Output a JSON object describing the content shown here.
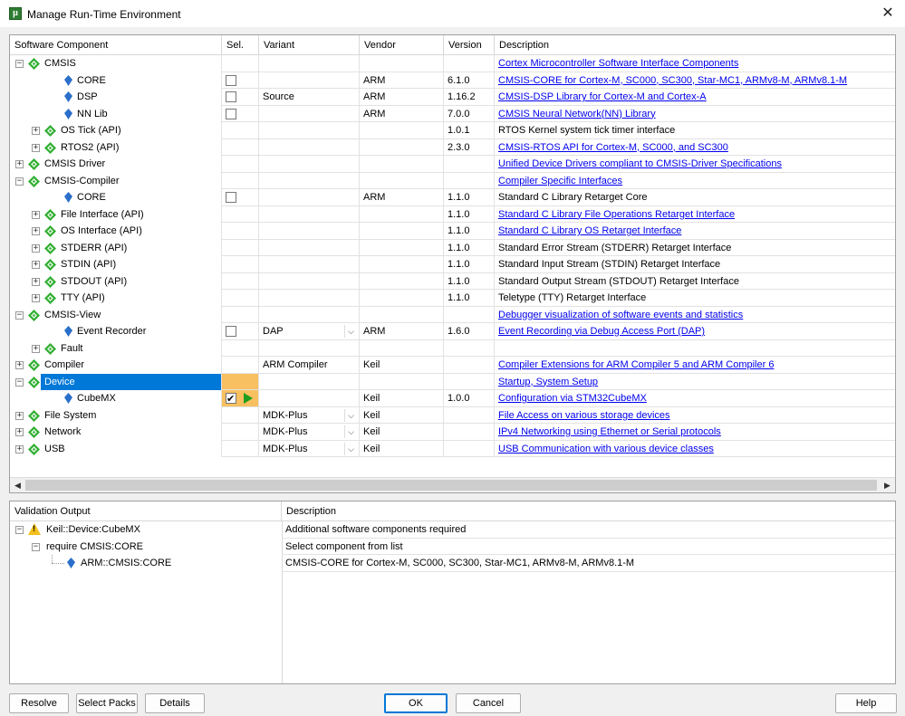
{
  "window": {
    "title": "Manage Run-Time Environment",
    "close": "✕"
  },
  "grid": {
    "headers": [
      "Software Component",
      "Sel.",
      "Variant",
      "Vendor",
      "Version",
      "Description"
    ],
    "rows": [
      {
        "name": "CMSIS",
        "level": 0,
        "exp": "−",
        "icon": "diamond",
        "sel": "",
        "variant": "",
        "dd": false,
        "vendor": "",
        "version": "",
        "desc": "Cortex Microcontroller Software Interface Components",
        "link": true
      },
      {
        "name": "CORE",
        "level": 1,
        "exp": "",
        "icon": "pin",
        "sel": "box",
        "variant": "",
        "dd": false,
        "vendor": "ARM",
        "version": "6.1.0",
        "desc": "CMSIS-CORE for Cortex-M, SC000, SC300, Star-MC1, ARMv8-M, ARMv8.1-M",
        "link": true
      },
      {
        "name": "DSP",
        "level": 1,
        "exp": "",
        "icon": "pin",
        "sel": "box",
        "variant": "Source",
        "dd": false,
        "vendor": "ARM",
        "version": "1.16.2",
        "desc": "CMSIS-DSP Library for Cortex-M and Cortex-A",
        "link": true
      },
      {
        "name": "NN Lib",
        "level": 1,
        "exp": "",
        "icon": "pin",
        "sel": "box",
        "variant": "",
        "dd": false,
        "vendor": "ARM",
        "version": "7.0.0",
        "desc": "CMSIS Neural Network(NN) Library",
        "link": true
      },
      {
        "name": "OS Tick (API)",
        "level": 1,
        "exp": "+",
        "icon": "diamond",
        "sel": "",
        "variant": "",
        "dd": false,
        "vendor": "",
        "version": "1.0.1",
        "desc": "RTOS Kernel system tick timer interface",
        "link": false
      },
      {
        "name": "RTOS2 (API)",
        "level": 1,
        "exp": "+",
        "icon": "diamond",
        "sel": "",
        "variant": "",
        "dd": false,
        "vendor": "",
        "version": "2.3.0",
        "desc": "CMSIS-RTOS API for Cortex-M, SC000, and SC300",
        "link": true
      },
      {
        "name": "CMSIS Driver",
        "level": 0,
        "exp": "+",
        "icon": "diamond",
        "sel": "",
        "variant": "",
        "dd": false,
        "vendor": "",
        "version": "",
        "desc": "Unified Device Drivers compliant to CMSIS-Driver Specifications",
        "link": true
      },
      {
        "name": "CMSIS-Compiler",
        "level": 0,
        "exp": "−",
        "icon": "diamond",
        "sel": "",
        "variant": "",
        "dd": false,
        "vendor": "",
        "version": "",
        "desc": "Compiler Specific Interfaces",
        "link": true
      },
      {
        "name": "CORE",
        "level": 1,
        "exp": "",
        "icon": "pin",
        "sel": "box",
        "variant": "",
        "dd": false,
        "vendor": "ARM",
        "version": "1.1.0",
        "desc": "Standard C Library Retarget Core",
        "link": false
      },
      {
        "name": "File Interface (API)",
        "level": 1,
        "exp": "+",
        "icon": "diamond",
        "sel": "",
        "variant": "",
        "dd": false,
        "vendor": "",
        "version": "1.1.0",
        "desc": "Standard C Library File Operations Retarget Interface",
        "link": true
      },
      {
        "name": "OS Interface (API)",
        "level": 1,
        "exp": "+",
        "icon": "diamond",
        "sel": "",
        "variant": "",
        "dd": false,
        "vendor": "",
        "version": "1.1.0",
        "desc": "Standard C Library OS Retarget Interface",
        "link": true
      },
      {
        "name": "STDERR (API)",
        "level": 1,
        "exp": "+",
        "icon": "diamond",
        "sel": "",
        "variant": "",
        "dd": false,
        "vendor": "",
        "version": "1.1.0",
        "desc": "Standard Error Stream (STDERR) Retarget Interface",
        "link": false
      },
      {
        "name": "STDIN (API)",
        "level": 1,
        "exp": "+",
        "icon": "diamond",
        "sel": "",
        "variant": "",
        "dd": false,
        "vendor": "",
        "version": "1.1.0",
        "desc": "Standard Input Stream (STDIN) Retarget Interface",
        "link": false
      },
      {
        "name": "STDOUT (API)",
        "level": 1,
        "exp": "+",
        "icon": "diamond",
        "sel": "",
        "variant": "",
        "dd": false,
        "vendor": "",
        "version": "1.1.0",
        "desc": "Standard Output Stream (STDOUT) Retarget Interface",
        "link": false
      },
      {
        "name": "TTY (API)",
        "level": 1,
        "exp": "+",
        "icon": "diamond",
        "sel": "",
        "variant": "",
        "dd": false,
        "vendor": "",
        "version": "1.1.0",
        "desc": "Teletype (TTY) Retarget Interface",
        "link": false
      },
      {
        "name": "CMSIS-View",
        "level": 0,
        "exp": "−",
        "icon": "diamond",
        "sel": "",
        "variant": "",
        "dd": false,
        "vendor": "",
        "version": "",
        "desc": "Debugger visualization of software events and statistics",
        "link": true
      },
      {
        "name": "Event Recorder",
        "level": 1,
        "exp": "",
        "icon": "pin",
        "sel": "box",
        "variant": "DAP",
        "dd": true,
        "vendor": "ARM",
        "version": "1.6.0",
        "desc": "Event Recording via Debug Access Port (DAP)",
        "link": true
      },
      {
        "name": "Fault",
        "level": 1,
        "exp": "+",
        "icon": "diamond",
        "sel": "",
        "variant": "",
        "dd": false,
        "vendor": "",
        "version": "",
        "desc": "",
        "link": false
      },
      {
        "name": "Compiler",
        "level": 0,
        "exp": "+",
        "icon": "diamond",
        "sel": "",
        "variant": "ARM Compiler",
        "dd": false,
        "vendor": "Keil",
        "version": "",
        "desc": "Compiler Extensions for ARM Compiler 5 and ARM Compiler 6",
        "link": true
      },
      {
        "name": "Device",
        "level": 0,
        "exp": "−",
        "icon": "diamond",
        "sel": "hl",
        "variant": "",
        "dd": false,
        "vendor": "",
        "version": "",
        "desc": "Startup, System Setup",
        "link": true,
        "selected": true
      },
      {
        "name": "CubeMX",
        "level": 1,
        "exp": "",
        "icon": "pin",
        "sel": "checked",
        "variant": "",
        "dd": false,
        "vendor": "Keil",
        "version": "1.0.0",
        "desc": "Configuration via STM32CubeMX",
        "link": true
      },
      {
        "name": "File System",
        "level": 0,
        "exp": "+",
        "icon": "diamond",
        "sel": "",
        "variant": "MDK-Plus",
        "dd": true,
        "vendor": "Keil",
        "version": "",
        "desc": "File Access on various storage devices",
        "link": true
      },
      {
        "name": "Network",
        "level": 0,
        "exp": "+",
        "icon": "diamond",
        "sel": "",
        "variant": "MDK-Plus",
        "dd": true,
        "vendor": "Keil",
        "version": "",
        "desc": "IPv4 Networking using Ethernet or Serial protocols",
        "link": true
      },
      {
        "name": "USB",
        "level": 0,
        "exp": "+",
        "icon": "diamond",
        "sel": "",
        "variant": "MDK-Plus",
        "dd": true,
        "vendor": "Keil",
        "version": "",
        "desc": "USB Communication with various device classes",
        "link": true
      }
    ]
  },
  "validation": {
    "headers": [
      "Validation Output",
      "Description"
    ],
    "rows": [
      {
        "label": "Keil::Device:CubeMX",
        "desc": "Additional software components required"
      },
      {
        "label": "require CMSIS:CORE",
        "desc": "Select component from list"
      },
      {
        "label": "ARM::CMSIS:CORE",
        "desc": "CMSIS-CORE for Cortex-M, SC000, SC300, Star-MC1, ARMv8-M, ARMv8.1-M"
      }
    ]
  },
  "buttons": {
    "resolve": "Resolve",
    "select_packs": "Select Packs",
    "details": "Details",
    "ok": "OK",
    "cancel": "Cancel",
    "help": "Help"
  },
  "scroll": {
    "left": "◀",
    "right": "▶"
  },
  "colors": {
    "diamond": "#2fae2f",
    "pin": "#2a6fc9",
    "selection": "#0078d7",
    "sel_highlight": "#f8c060",
    "link": "#0000ee"
  }
}
